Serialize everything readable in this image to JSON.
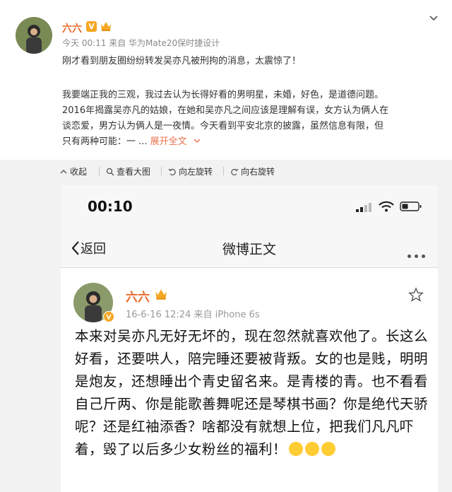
{
  "post": {
    "author": "六六",
    "verified_badge": "V",
    "meta": "今天 00:11 来自 华为Mate20保时捷设计",
    "line1": "刚才看到朋友圈纷纷转发吴亦凡被刑拘的消息，太震惊了！",
    "body_lines": [
      "我要端正我的三观，我过去认为长得好看的男明星，未婚，好色，是道德问题。",
      "2016年揭露吴亦凡的姑娘，在她和吴亦凡之间应该是理解有误，女方认为俩人在",
      "谈恋爱，男方认为俩人是一夜情。今天看到平安北京的披露，虽然信息有限，但",
      "只有两种可能：一 ..."
    ],
    "expand_label": "展开全文",
    "accent": "#eb7350"
  },
  "toolbar": {
    "collapse": "收起",
    "view_large": "查看大图",
    "rotate_left": "向左旋转",
    "rotate_right": "向右旋转"
  },
  "phone": {
    "time": "00:10",
    "back_label": "返回",
    "title": "微博正文",
    "author": "六六",
    "meta": "16-6-16 12:24  来自 iPhone 6s",
    "text": "本来对吴亦凡无好无坏的，现在忽然就喜欢他了。长这么好看，还要哄人，陪完睡还要被背叛。女的也是贱，明明是炮友，还想睡出个青史留名来。是青楼的青。也不看看自己斤两、你是能歌善舞呢还是琴棋书画？你是绝代天骄呢？还是红袖添香？啥都没有就想上位，把我们凡凡吓着，毁了以后多少女粉丝的福利！"
  }
}
